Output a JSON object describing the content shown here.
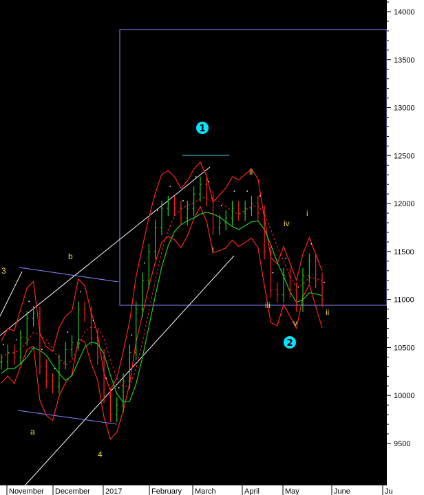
{
  "chart_data": {
    "type": "line",
    "title": "",
    "xlabel": "",
    "ylabel": "",
    "ylim": [
      9150,
      14150
    ],
    "y_ticks": [
      9500,
      10000,
      10500,
      11000,
      11500,
      12000,
      12500,
      13000,
      13500,
      14000
    ],
    "x_ticks": [
      "November",
      "December",
      "2017",
      "February",
      "March",
      "April",
      "May",
      "June",
      "Ju"
    ],
    "series": [
      {
        "values": [
          10350,
          10450,
          10400,
          10600,
          10800,
          10850,
          10300,
          10150,
          10100,
          10350,
          10480,
          10550,
          10900,
          10850,
          10600,
          10400,
          10000,
          9800,
          9900,
          10150,
          10450,
          10900,
          11200,
          11500,
          11750,
          11950,
          12000,
          11950,
          11850,
          11950,
          12100,
          12200,
          12050,
          11750,
          11800,
          11850,
          11950,
          11900,
          11950,
          12000,
          11900,
          11500,
          11100,
          11050,
          11250,
          11100,
          10950,
          11250,
          11400,
          11200,
          11000
        ]
      }
    ],
    "colors": {
      "background": "#000000",
      "axis_panel": "#ffffff",
      "candle_up": "#22cc22",
      "candle_down": "#ff2222",
      "bands": "#ff2222",
      "moving_average": "#22cc22",
      "channels": "#ffffff",
      "box": "#8888ff",
      "wave_labels": "#e8d84a",
      "circle_labels": "#00e5ff"
    },
    "wave_labels": [
      {
        "text": "3",
        "x": "Oct",
        "y": 11100
      },
      {
        "text": "b",
        "x": "mid-November",
        "y": 11150
      },
      {
        "text": "a",
        "x": "early November",
        "y": 9600
      },
      {
        "text": "4",
        "x": "late December",
        "y": 9450
      },
      {
        "text": "i",
        "x": "early March",
        "y": 11380
      },
      {
        "text": "ii",
        "x": "late March",
        "y": 12150
      },
      {
        "text": "iii",
        "x": "early April",
        "y": 10700
      },
      {
        "text": "iv",
        "x": "late April",
        "y": 11560
      },
      {
        "text": "v",
        "x": "early May",
        "y": 10650
      },
      {
        "text": "i",
        "x": "mid-May",
        "y": 11700
      },
      {
        "text": "ii",
        "x": "late May",
        "y": 10700
      }
    ],
    "circle_labels": [
      {
        "text": "1",
        "x": "late February",
        "y": 12650
      },
      {
        "text": "2",
        "x": "early May",
        "y": 10410
      }
    ]
  }
}
